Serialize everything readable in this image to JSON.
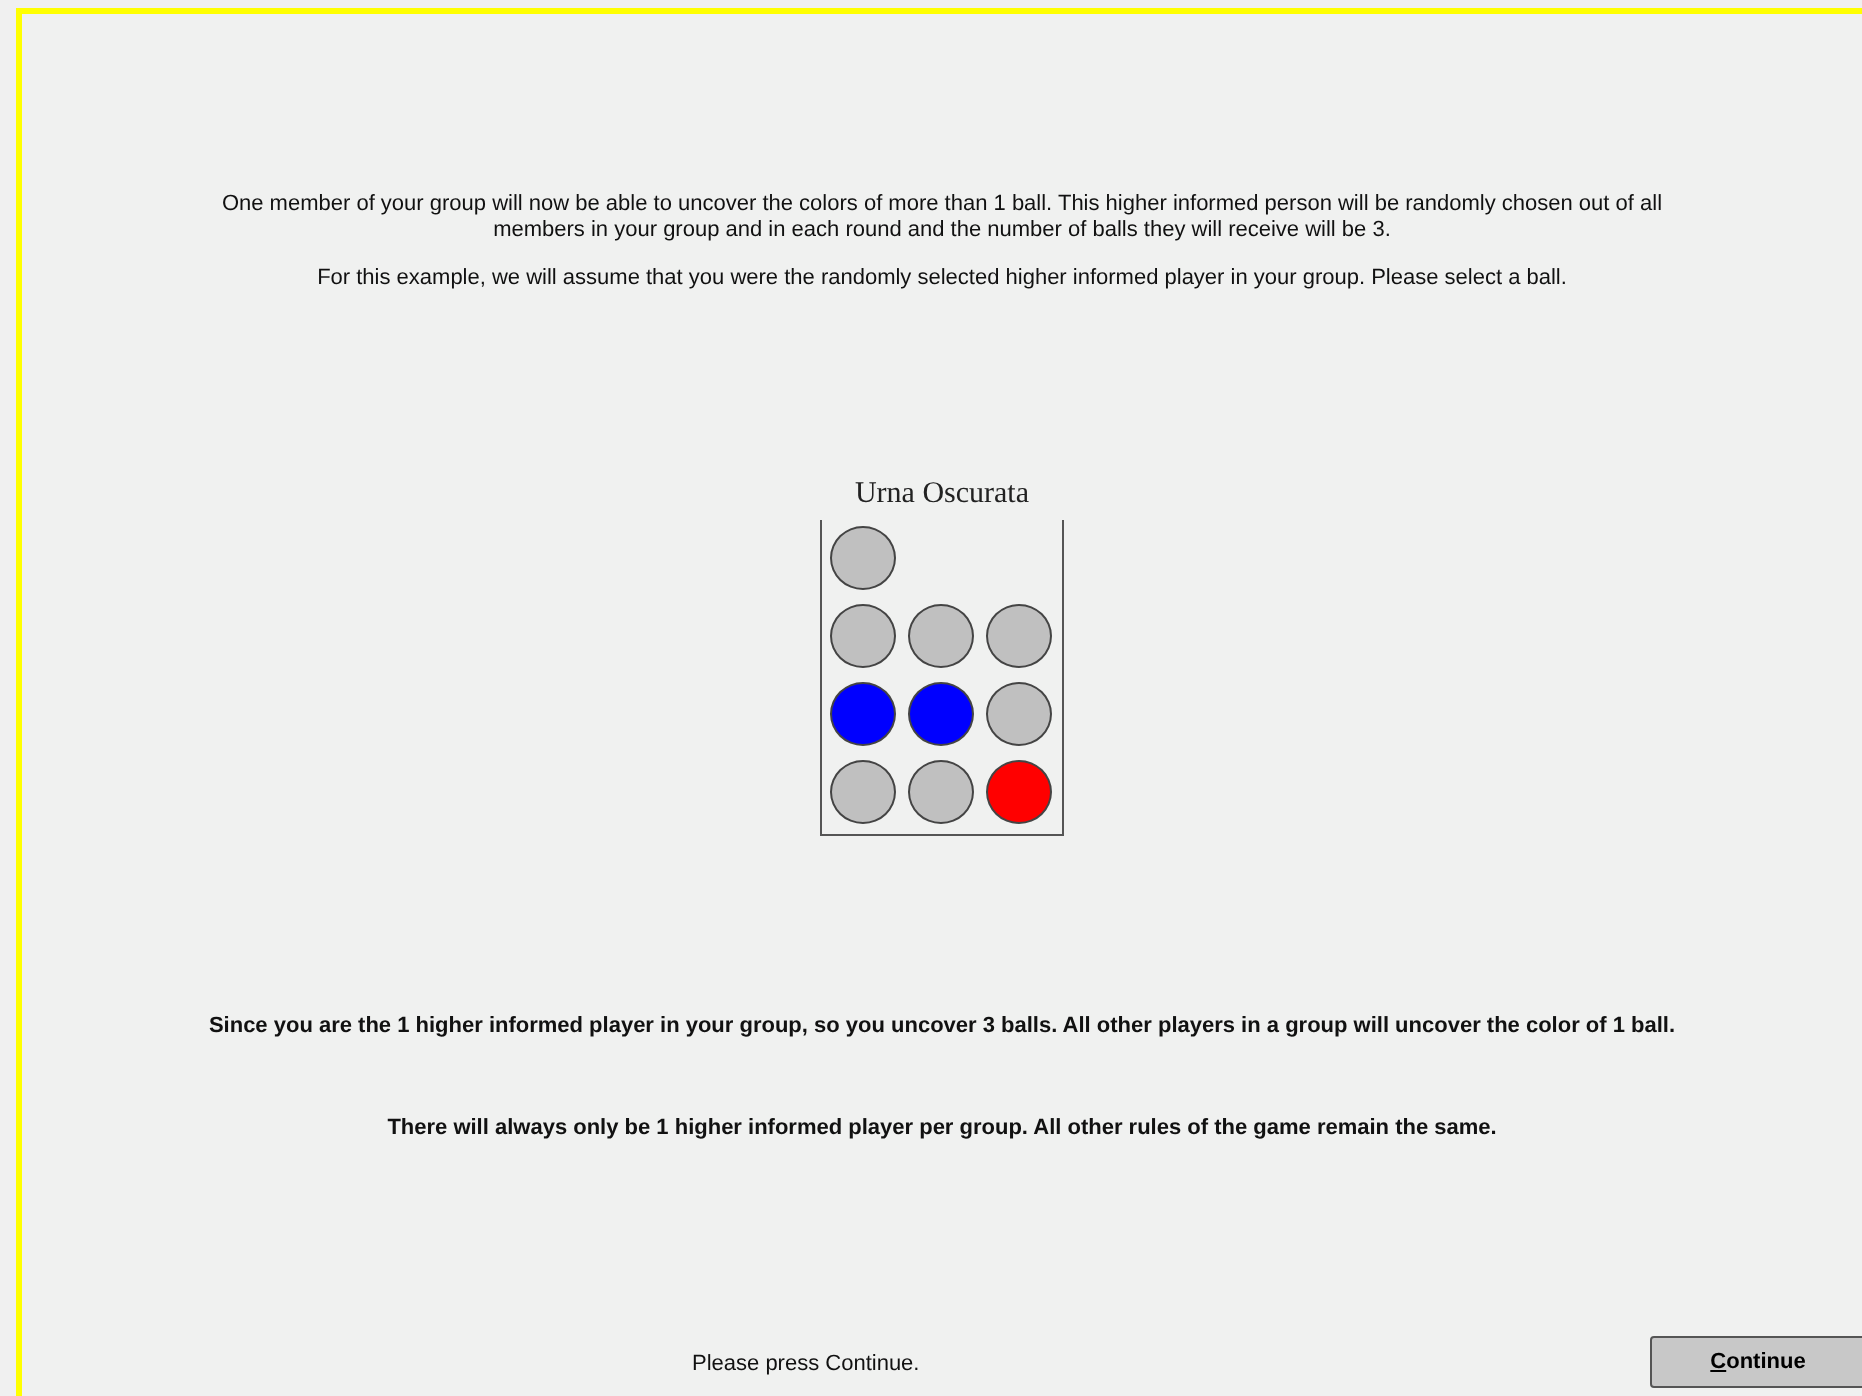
{
  "intro": [
    "One member of your group will now be able to uncover the colors of more than 1 ball. This higher informed person will be randomly chosen out of all members in your group and in each round and the number of balls they will receive will be 3.",
    "For this example, we will assume that you were the randomly selected higher informed player in your group. Please select a ball."
  ],
  "urn": {
    "title": "Urna Oscurata",
    "rows": [
      [
        {
          "color": "#c0c0c0"
        }
      ],
      [
        {
          "color": "#c0c0c0"
        },
        {
          "color": "#c0c0c0"
        },
        {
          "color": "#c0c0c0"
        }
      ],
      [
        {
          "color": "#0000ff"
        },
        {
          "color": "#0000ff"
        },
        {
          "color": "#c0c0c0"
        }
      ],
      [
        {
          "color": "#c0c0c0"
        },
        {
          "color": "#c0c0c0"
        },
        {
          "color": "#ff0000"
        }
      ]
    ]
  },
  "notes": [
    "Since you are the 1 higher informed player in your group, so you uncover 3 balls. All other players in a group will uncover the color of 1 ball.",
    "There will always only be 1 higher informed player per group. All other rules of the game remain the same."
  ],
  "footer": {
    "hint": "Please press Continue.",
    "button": "Continue"
  }
}
